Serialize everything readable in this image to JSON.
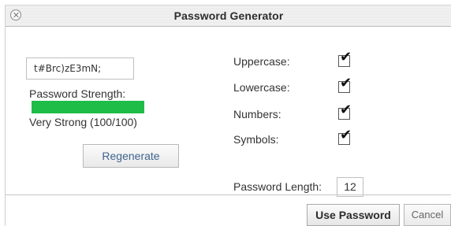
{
  "dialog": {
    "title": "Password Generator",
    "close_icon": "close-x-icon"
  },
  "password": {
    "value": "t#Brc)zE3mN;"
  },
  "strength": {
    "label": "Password Strength:",
    "text": "Very Strong (100/100)",
    "score": 100,
    "color": "#1dbd48"
  },
  "regenerate_label": "Regenerate",
  "options": {
    "uppercase": {
      "label": "Uppercase:",
      "checked": true
    },
    "lowercase": {
      "label": "Lowercase:",
      "checked": true
    },
    "numbers": {
      "label": "Numbers:",
      "checked": true
    },
    "symbols": {
      "label": "Symbols:",
      "checked": true
    },
    "checkmark_glyph": "✔"
  },
  "length": {
    "label": "Password Length:",
    "value": "12"
  },
  "footer": {
    "use_label": "Use Password",
    "cancel_label": "Cancel"
  }
}
